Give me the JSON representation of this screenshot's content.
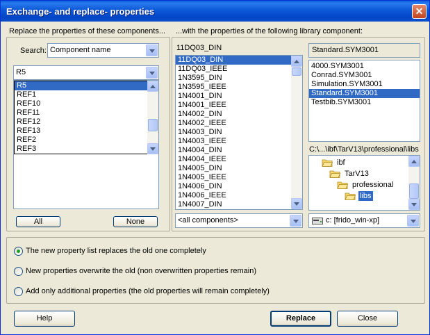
{
  "window": {
    "title": "Exchange- and replace- properties",
    "close_label": "✕"
  },
  "left": {
    "group_label": "Replace the properties of these components...",
    "search_label": "Search:",
    "search_value": "Component name",
    "filter_value": "R5",
    "items": [
      "R5",
      "REF1",
      "REF10",
      "REF11",
      "REF12",
      "REF13",
      "REF2",
      "REF3"
    ],
    "selected_index": 0,
    "all_button": "All",
    "none_button": "None"
  },
  "right": {
    "header_label": "...with the properties of the following library component:",
    "component_value": "11DQ03_DIN",
    "components": [
      "11DQ03_DIN",
      "11DQ03_IEEE",
      "1N3595_DIN",
      "1N3595_IEEE",
      "1N4001_DIN",
      "1N4001_IEEE",
      "1N4002_DIN",
      "1N4002_IEEE",
      "1N4003_DIN",
      "1N4003_IEEE",
      "1N4004_DIN",
      "1N4004_IEEE",
      "1N4005_DIN",
      "1N4005_IEEE",
      "1N4006_DIN",
      "1N4006_IEEE",
      "1N4007_DIN"
    ],
    "components_selected_index": 0,
    "components_filter": "<all components>",
    "library_value": "Standard.SYM3001",
    "libraries": [
      "4000.SYM3001",
      "Conrad.SYM3001",
      "Simulation.SYM3001",
      "Standard.SYM3001",
      "Testbib.SYM3001"
    ],
    "libraries_selected_index": 3,
    "path_label": "C:\\...\\ibf\\TarV13\\professional\\libs",
    "folders": [
      {
        "label": "ibf",
        "indent": 0
      },
      {
        "label": "TarV13",
        "indent": 1
      },
      {
        "label": "professional",
        "indent": 2
      },
      {
        "label": "libs",
        "indent": 3
      }
    ],
    "folders_selected_index": 3,
    "drive_value": "c: [frido_win-xp]"
  },
  "options": {
    "replace_all": "The new property list replaces the old one completely",
    "overwrite": "New properties overwrite the old (non overwritten properties remain)",
    "add_only": "Add only additional properties (the old properties will remain completely)",
    "selected": "replace_all"
  },
  "footer": {
    "help": "Help",
    "replace": "Replace",
    "close": "Close"
  },
  "colors": {
    "titlebar": "#0a4ec9",
    "selection": "#316ac5",
    "face": "#ece9d8"
  },
  "icons": {
    "folder": "folder-icon",
    "drive": "drive-icon"
  }
}
